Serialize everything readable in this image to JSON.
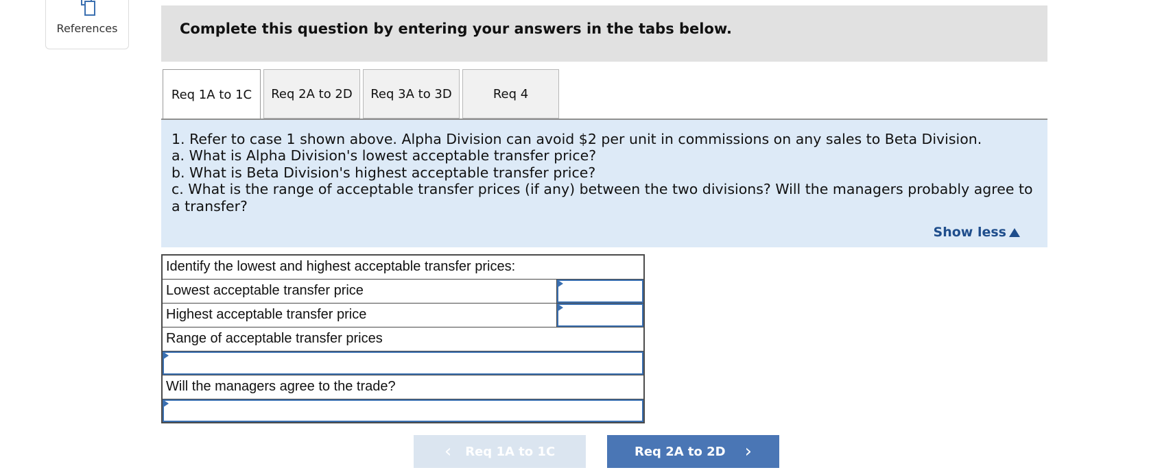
{
  "references": {
    "label": "References",
    "icon": "copy-icon"
  },
  "banner": {
    "text": "Complete this question by entering your answers in the tabs below."
  },
  "tabs": [
    {
      "label": "Req 1A to 1C",
      "active": true
    },
    {
      "label": "Req 2A to 2D",
      "active": false
    },
    {
      "label": "Req 3A to 3D",
      "active": false
    },
    {
      "label": "Req 4",
      "active": false
    }
  ],
  "prompt": {
    "lines": [
      "1. Refer to case 1 shown above. Alpha Division can avoid $2 per unit in commissions on any sales to Beta Division.",
      "a. What is Alpha Division's lowest acceptable transfer price?",
      "b. What is Beta Division's highest acceptable transfer price?",
      "c. What is the range of acceptable transfer prices (if any) between the two divisions? Will the managers probably agree to",
      "a transfer?"
    ],
    "show_less": "Show less"
  },
  "table": {
    "header": "Identify the lowest and highest acceptable transfer prices:",
    "rows": [
      {
        "label": "Lowest acceptable transfer price",
        "value": ""
      },
      {
        "label": "Highest acceptable transfer price",
        "value": ""
      }
    ],
    "range_label": "Range of acceptable transfer prices",
    "range_value": "",
    "agree_label": "Will the managers agree to the trade?",
    "agree_value": ""
  },
  "nav": {
    "prev_label": "Req 1A to 1C",
    "next_label": "Req 2A to 2D"
  },
  "colors": {
    "prompt_bg": "#ddeaf7",
    "accent": "#4a76b5",
    "banner_bg": "#e1e1e1"
  }
}
